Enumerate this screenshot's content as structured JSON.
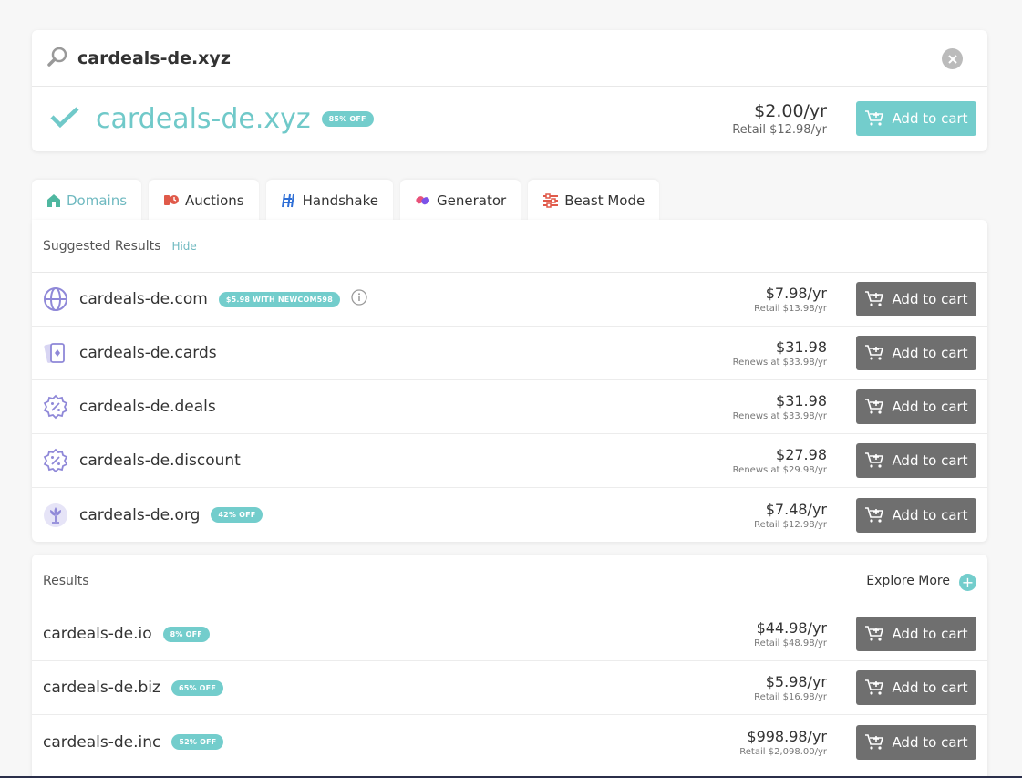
{
  "search": {
    "value": "cardeals-de.xyz"
  },
  "hero": {
    "domain": "cardeals-de.xyz",
    "badge": "85% OFF",
    "price": "$2.00/yr",
    "retail": "Retail $12.98/yr",
    "cart_label": "Add to cart"
  },
  "tabs": [
    {
      "label": "Domains",
      "icon": "home-icon",
      "active": true
    },
    {
      "label": "Auctions",
      "icon": "auction-clock-icon"
    },
    {
      "label": "Handshake",
      "icon": "handshake-icon"
    },
    {
      "label": "Generator",
      "icon": "generator-icon"
    },
    {
      "label": "Beast Mode",
      "icon": "sliders-icon"
    }
  ],
  "suggested": {
    "title": "Suggested Results",
    "hide_label": "Hide",
    "items": [
      {
        "name": "cardeals-de.com",
        "icon": "globe-icon",
        "badge": "$5.98 WITH NEWCOM598",
        "price": "$7.98/yr",
        "sub": "Retail $13.98/yr",
        "cart_label": "Add to cart"
      },
      {
        "name": "cardeals-de.cards",
        "icon": "cards-icon",
        "badge": "",
        "price": "$31.98",
        "sub": "Renews at $33.98/yr",
        "cart_label": "Add to cart"
      },
      {
        "name": "cardeals-de.deals",
        "icon": "discount-icon",
        "badge": "",
        "price": "$31.98",
        "sub": "Renews at $33.98/yr",
        "cart_label": "Add to cart"
      },
      {
        "name": "cardeals-de.discount",
        "icon": "discount-icon",
        "badge": "",
        "price": "$27.98",
        "sub": "Renews at $29.98/yr",
        "cart_label": "Add to cart"
      },
      {
        "name": "cardeals-de.org",
        "icon": "org-icon",
        "badge": "42% OFF",
        "price": "$7.48/yr",
        "sub": "Retail $12.98/yr",
        "cart_label": "Add to cart"
      }
    ]
  },
  "results": {
    "title": "Results",
    "explore_label": "Explore More",
    "items": [
      {
        "name": "cardeals-de.io",
        "badge": "8% OFF",
        "price": "$44.98/yr",
        "sub": "Retail $48.98/yr",
        "cart_label": "Add to cart"
      },
      {
        "name": "cardeals-de.biz",
        "badge": "65% OFF",
        "price": "$5.98/yr",
        "sub": "Retail $16.98/yr",
        "cart_label": "Add to cart"
      },
      {
        "name": "cardeals-de.inc",
        "badge": "52% OFF",
        "price": "$998.98/yr",
        "sub": "Retail $2,098.00/yr",
        "cart_label": "Add to cart"
      }
    ]
  },
  "colors": {
    "accent": "#73cdcc",
    "dark_button": "#6f6f6f"
  }
}
